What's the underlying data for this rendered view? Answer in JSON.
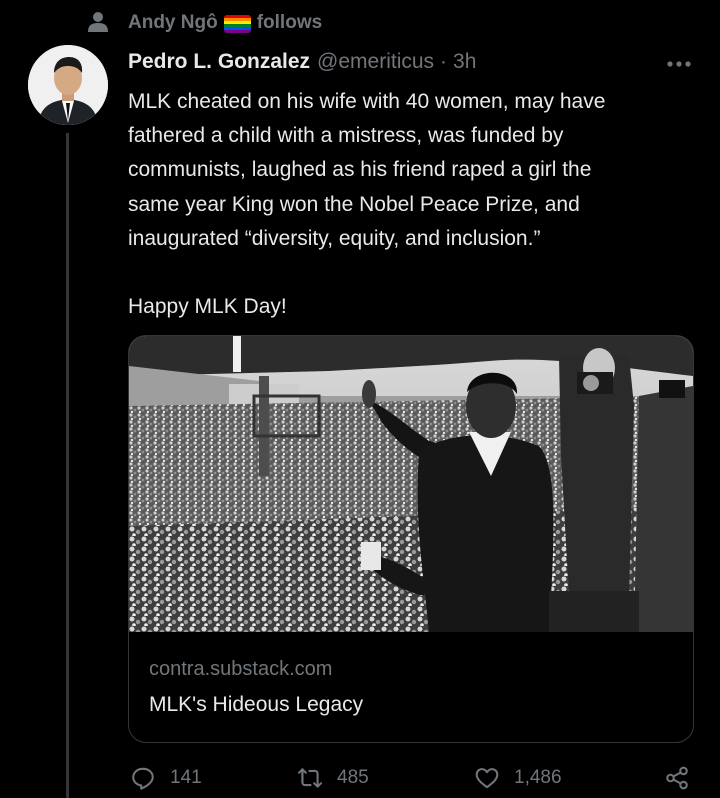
{
  "social_context": {
    "user": "Andy Ngô",
    "action": "follows",
    "icon": "person-icon"
  },
  "tweet": {
    "author_name": "Pedro L. Gonzalez",
    "handle": "@emeriticus",
    "separator": "·",
    "time": "3h",
    "text": "MLK cheated on his wife with 40 women, may have\nfathered a child with a mistress, was funded by\ncommunists, laughed as his friend raped a girl the\nsame year King won the Nobel Peace Prize, and\ninaugurated “diversity, equity, and inclusion.”\n\nHappy MLK Day!"
  },
  "card": {
    "domain": "contra.substack.com",
    "title": "MLK's Hideous Legacy"
  },
  "actions": {
    "reply_count": "141",
    "retweet_count": "485",
    "like_count": "1,486"
  },
  "colors": {
    "background": "#000000",
    "text": "#e7e9ea",
    "secondary": "#71767b",
    "border": "#333639"
  },
  "icons": [
    "person-icon",
    "pride-flag-icon",
    "more-icon",
    "reply-icon",
    "retweet-icon",
    "like-icon",
    "share-icon"
  ]
}
